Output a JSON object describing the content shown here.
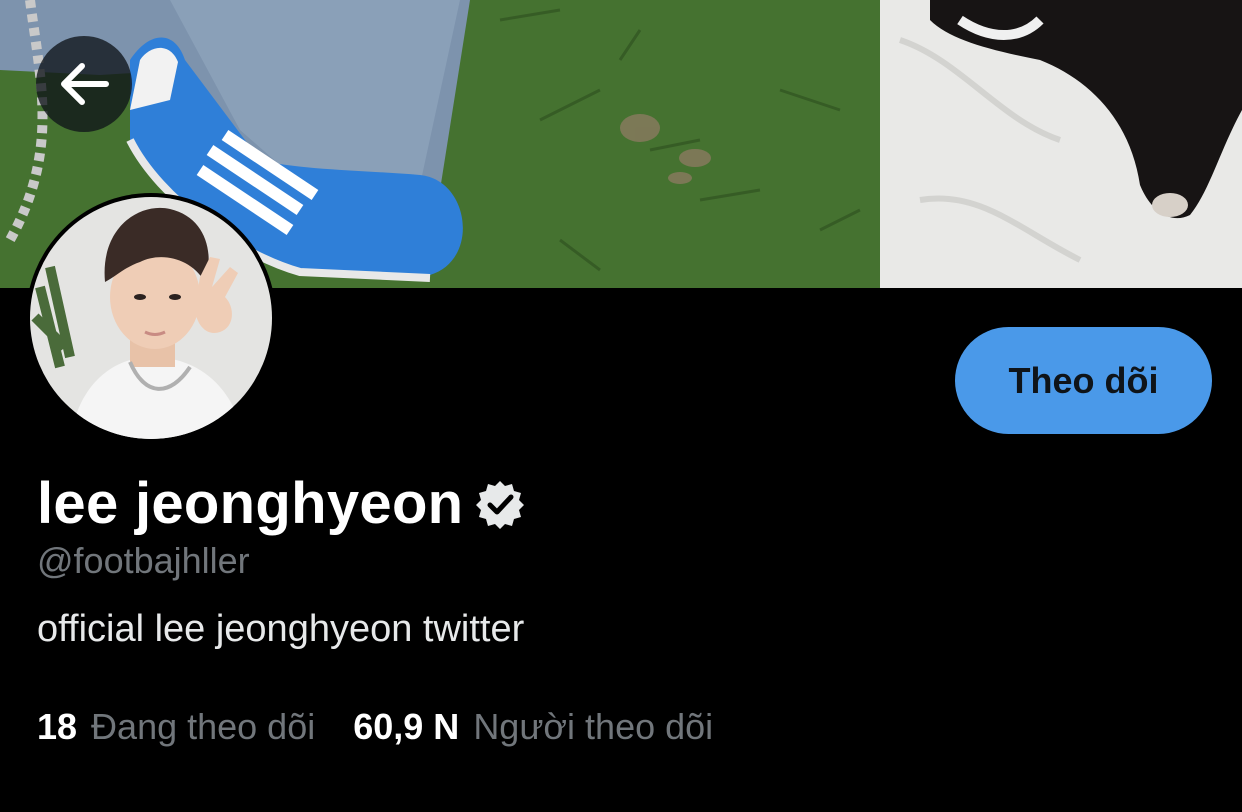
{
  "profile": {
    "display_name": "lee jeonghyeon",
    "handle": "@footbajhller",
    "bio": "official lee jeonghyeon twitter",
    "verified": true,
    "following_count": "18",
    "following_label": "Đang theo dõi",
    "followers_count": "60,9 N",
    "followers_label": "Người theo dõi"
  },
  "actions": {
    "follow_label": "Theo dõi"
  },
  "icons": {
    "back": "arrow-left-icon",
    "verified": "verified-badge-icon"
  },
  "colors": {
    "background": "#000000",
    "follow_button": "#4a99e9",
    "secondary_text": "#71767b"
  }
}
